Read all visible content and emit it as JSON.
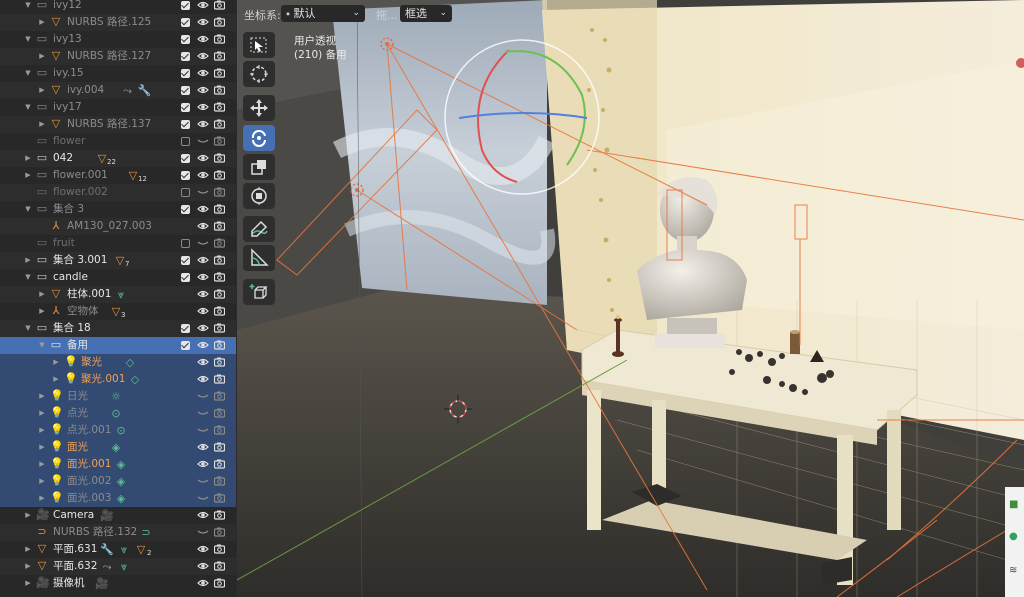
{
  "outliner": {
    "rows": [
      {
        "label": "ivy12",
        "indent": 1,
        "arrow": "open",
        "icon": "collection-icon",
        "icon_color": "#8c8c8c",
        "text_class": "c-gray",
        "check": "on",
        "eye": true
      },
      {
        "label": "NURBS 路径.125",
        "indent": 2,
        "arrow": "closed",
        "icon": "mesh-icon",
        "icon_color": "#e8963c",
        "text_class": "c-gray",
        "check": "on",
        "eye": true
      },
      {
        "label": "ivy13",
        "indent": 1,
        "arrow": "open",
        "icon": "collection-icon",
        "icon_color": "#8c8c8c",
        "text_class": "c-gray",
        "check": "on",
        "eye": true
      },
      {
        "label": "NURBS 路径.127",
        "indent": 2,
        "arrow": "closed",
        "icon": "mesh-icon",
        "icon_color": "#e8963c",
        "text_class": "c-gray",
        "check": "on",
        "eye": true
      },
      {
        "label": "ivy.15",
        "indent": 1,
        "arrow": "open",
        "icon": "collection-icon",
        "icon_color": "#8c8c8c",
        "text_class": "c-gray",
        "check": "on",
        "eye": true
      },
      {
        "label": "ivy.004",
        "indent": 2,
        "arrow": "closed",
        "icon": "mesh-icon",
        "icon_color": "#e8963c",
        "text_class": "c-gray",
        "check": "on",
        "eye": true,
        "extras": [
          "constraint-icon",
          "modifier-icon"
        ]
      },
      {
        "label": "ivy17",
        "indent": 1,
        "arrow": "open",
        "icon": "collection-icon",
        "icon_color": "#8c8c8c",
        "text_class": "c-gray",
        "check": "on",
        "eye": true
      },
      {
        "label": "NURBS 路径.137",
        "indent": 2,
        "arrow": "closed",
        "icon": "mesh-icon",
        "icon_color": "#e8963c",
        "text_class": "c-gray",
        "check": "on",
        "eye": true
      },
      {
        "label": "flower",
        "indent": 1,
        "arrow": "none",
        "icon": "collection-icon",
        "icon_color": "#6f6f6f",
        "text_class": "c-dim",
        "check": "off",
        "eye": false
      },
      {
        "label": "042",
        "indent": 1,
        "arrow": "closed",
        "icon": "collection-icon",
        "icon_color": "#c8c8c8",
        "text_class": "c-white",
        "check": "on",
        "eye": true,
        "badge": "22"
      },
      {
        "label": "flower.001",
        "indent": 1,
        "arrow": "closed",
        "icon": "collection-icon",
        "icon_color": "#8c8c8c",
        "text_class": "c-gray",
        "check": "on",
        "eye": true,
        "badge": "12"
      },
      {
        "label": "flower.002",
        "indent": 1,
        "arrow": "none",
        "icon": "collection-icon",
        "icon_color": "#6f6f6f",
        "text_class": "c-dim",
        "check": "off",
        "eye": false
      },
      {
        "label": "集合 3",
        "indent": 1,
        "arrow": "open",
        "icon": "collection-icon",
        "icon_color": "#8c8c8c",
        "text_class": "c-gray",
        "check": "on",
        "eye": true
      },
      {
        "label": "AM130_027.003",
        "indent": 2,
        "arrow": "none",
        "icon": "empty-icon",
        "icon_color": "#e8963c",
        "text_class": "c-gray",
        "check": "",
        "eye": true
      },
      {
        "label": "fruit",
        "indent": 1,
        "arrow": "none",
        "icon": "collection-icon",
        "icon_color": "#6f6f6f",
        "text_class": "c-dim",
        "check": "off",
        "eye": false
      },
      {
        "label": "集合 3.001",
        "indent": 1,
        "arrow": "closed",
        "icon": "collection-icon",
        "icon_color": "#c8c8c8",
        "text_class": "c-white",
        "check": "on",
        "eye": true,
        "badge": "7"
      },
      {
        "label": "candle",
        "indent": 1,
        "arrow": "open",
        "icon": "collection-icon",
        "icon_color": "#c8c8c8",
        "text_class": "c-white",
        "check": "on",
        "eye": true
      },
      {
        "label": "柱体.001",
        "indent": 2,
        "arrow": "closed",
        "icon": "mesh-icon",
        "icon_color": "#e8963c",
        "text_class": "c-white",
        "check": "",
        "eye": true,
        "extras": [
          "vertex-group-icon"
        ]
      },
      {
        "label": "空物体",
        "indent": 2,
        "arrow": "closed",
        "icon": "empty-icon",
        "icon_color": "#e8963c",
        "text_class": "c-gray",
        "check": "",
        "eye": true,
        "badge": "3"
      },
      {
        "label": "集合 18",
        "indent": 1,
        "arrow": "open",
        "icon": "collection-icon",
        "icon_color": "#c8c8c8",
        "text_class": "c-white",
        "check": "on",
        "eye": true
      },
      {
        "label": "备用",
        "indent": 2,
        "arrow": "open",
        "icon": "collection-icon",
        "icon_color": "#e6e6e6",
        "text_class": "c-white",
        "check": "on",
        "eye": true,
        "state": "active"
      },
      {
        "label": "聚光",
        "indent": 3,
        "arrow": "closed",
        "icon": "light-icon",
        "icon_color": "#e8963c",
        "text_class": "c-sel",
        "check": "",
        "eye": true,
        "state": "sel",
        "extras": [
          "light-data-icon"
        ]
      },
      {
        "label": "聚光.001",
        "indent": 3,
        "arrow": "closed",
        "icon": "light-icon",
        "icon_color": "#e8963c",
        "text_class": "c-sel",
        "check": "",
        "eye": true,
        "state": "sel",
        "extras": [
          "light-data-icon"
        ]
      },
      {
        "label": "日光",
        "indent": 2,
        "arrow": "closed",
        "icon": "light-icon",
        "icon_color": "#8c8c8c",
        "text_class": "c-gray",
        "check": "",
        "eye": false,
        "state": "sel",
        "extras": [
          "sun-icon"
        ]
      },
      {
        "label": "点光",
        "indent": 2,
        "arrow": "closed",
        "icon": "light-icon",
        "icon_color": "#8c8c8c",
        "text_class": "c-gray",
        "check": "",
        "eye": false,
        "state": "sel",
        "extras": [
          "point-light-icon"
        ]
      },
      {
        "label": "点光.001",
        "indent": 2,
        "arrow": "closed",
        "icon": "light-icon",
        "icon_color": "#8c8c8c",
        "text_class": "c-gray",
        "check": "",
        "eye": false,
        "state": "sel",
        "extras": [
          "point-light-icon"
        ]
      },
      {
        "label": "面光",
        "indent": 2,
        "arrow": "closed",
        "icon": "light-icon",
        "icon_color": "#e8963c",
        "text_class": "c-sel",
        "check": "",
        "eye": true,
        "state": "sel",
        "extras": [
          "area-light-icon"
        ]
      },
      {
        "label": "面光.001",
        "indent": 2,
        "arrow": "closed",
        "icon": "light-icon",
        "icon_color": "#e8963c",
        "text_class": "c-sel",
        "check": "",
        "eye": true,
        "state": "sel",
        "extras": [
          "area-light-icon"
        ]
      },
      {
        "label": "面光.002",
        "indent": 2,
        "arrow": "closed",
        "icon": "light-icon",
        "icon_color": "#8c8c8c",
        "text_class": "c-gray",
        "check": "",
        "eye": false,
        "state": "sel",
        "extras": [
          "area-light-icon"
        ]
      },
      {
        "label": "面光.003",
        "indent": 2,
        "arrow": "closed",
        "icon": "light-icon",
        "icon_color": "#8c8c8c",
        "text_class": "c-gray",
        "check": "",
        "eye": false,
        "state": "sel",
        "extras": [
          "area-light-icon"
        ]
      },
      {
        "label": "Camera",
        "indent": 1,
        "arrow": "closed",
        "icon": "camera-icon",
        "icon_color": "#e8963c",
        "text_class": "c-white",
        "check": "",
        "eye": true,
        "extras": [
          "camera-data-icon"
        ]
      },
      {
        "label": "NURBS 路径.132",
        "indent": 1,
        "arrow": "none",
        "icon": "curve-icon",
        "icon_color": "#e8963c",
        "text_class": "c-gray",
        "check": "",
        "eye": false,
        "extras": [
          "curve-data-icon"
        ]
      },
      {
        "label": "平面.631",
        "indent": 1,
        "arrow": "closed",
        "icon": "mesh-icon",
        "icon_color": "#e8963c",
        "text_class": "c-white",
        "check": "",
        "eye": true,
        "extras": [
          "modifier-icon",
          "vertex-group-icon",
          "mesh-data-icon"
        ],
        "badge2": "2"
      },
      {
        "label": "平面.632",
        "indent": 1,
        "arrow": "closed",
        "icon": "mesh-icon",
        "icon_color": "#e8963c",
        "text_class": "c-white",
        "check": "",
        "eye": true,
        "extras": [
          "constraint-icon",
          "vertex-group-icon"
        ]
      },
      {
        "label": "摄像机",
        "indent": 1,
        "arrow": "closed",
        "icon": "camera-icon",
        "icon_color": "#e8963c",
        "text_class": "c-white",
        "check": "",
        "eye": true,
        "extras": [
          "camera-data-icon"
        ]
      }
    ]
  },
  "viewport": {
    "header": {
      "orientation_label": "坐标系:",
      "orientation_value": "默认",
      "drag_label": "拖...",
      "drag_value": "框选"
    },
    "overlay": {
      "view_name": "用户透视",
      "collection_info": "(210) 备用"
    },
    "tools": [
      {
        "name": "select-box-tool",
        "active": false
      },
      {
        "name": "cursor-tool",
        "active": false
      },
      {
        "name": "move-tool",
        "active": false
      },
      {
        "name": "rotate-tool",
        "active": true
      },
      {
        "name": "scale-tool",
        "active": false
      },
      {
        "name": "transform-tool",
        "active": false
      },
      {
        "name": "annotate-tool",
        "active": false
      },
      {
        "name": "measure-tool",
        "active": false
      },
      {
        "name": "add-cube-tool",
        "active": false
      }
    ],
    "colors": {
      "selection_outline": "#e8743c",
      "active_highlight": "#4670b4",
      "gizmo_x": "#e05050",
      "gizmo_y": "#6cc050",
      "gizmo_z": "#5080e0"
    }
  }
}
